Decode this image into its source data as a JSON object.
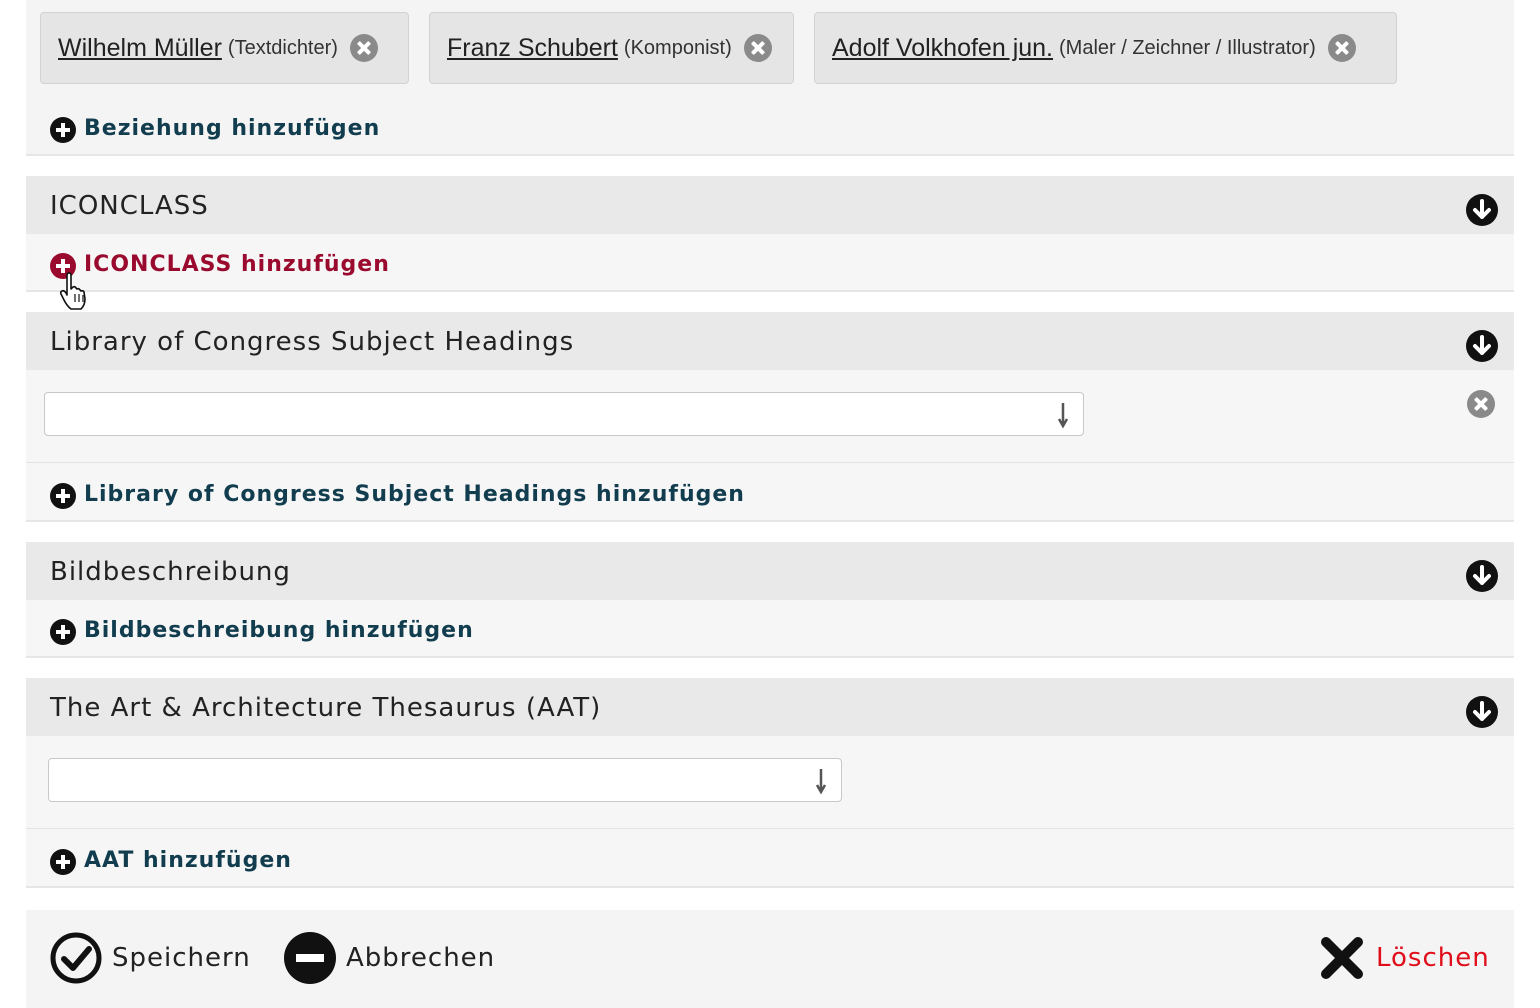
{
  "relations": {
    "tags": [
      {
        "name": "Wilhelm Müller",
        "role": "(Textdichter)"
      },
      {
        "name": "Franz Schubert",
        "role": "(Komponist)"
      },
      {
        "name": "Adolf Volkhofen jun.",
        "role": "(Maler / Zeichner / Illustrator)"
      }
    ],
    "add_label": "Beziehung hinzufügen"
  },
  "iconclass": {
    "title": "ICONCLASS",
    "add_label": "ICONCLASS hinzufügen"
  },
  "lcsh": {
    "title": "Library of Congress Subject Headings",
    "select_value": "",
    "add_label": "Library of Congress Subject Headings hinzufügen"
  },
  "bildbeschreibung": {
    "title": "Bildbeschreibung",
    "add_label": "Bildbeschreibung hinzufügen"
  },
  "aat": {
    "title": "The Art & Architecture Thesaurus (AAT)",
    "select_value": "",
    "add_label": "AAT hinzufügen"
  },
  "footer": {
    "save_label": "Speichern",
    "cancel_label": "Abbrechen",
    "delete_label": "Löschen"
  },
  "colors": {
    "link": "#113d4f",
    "link_hover": "#9a0a2e",
    "delete": "#e00d1a"
  }
}
